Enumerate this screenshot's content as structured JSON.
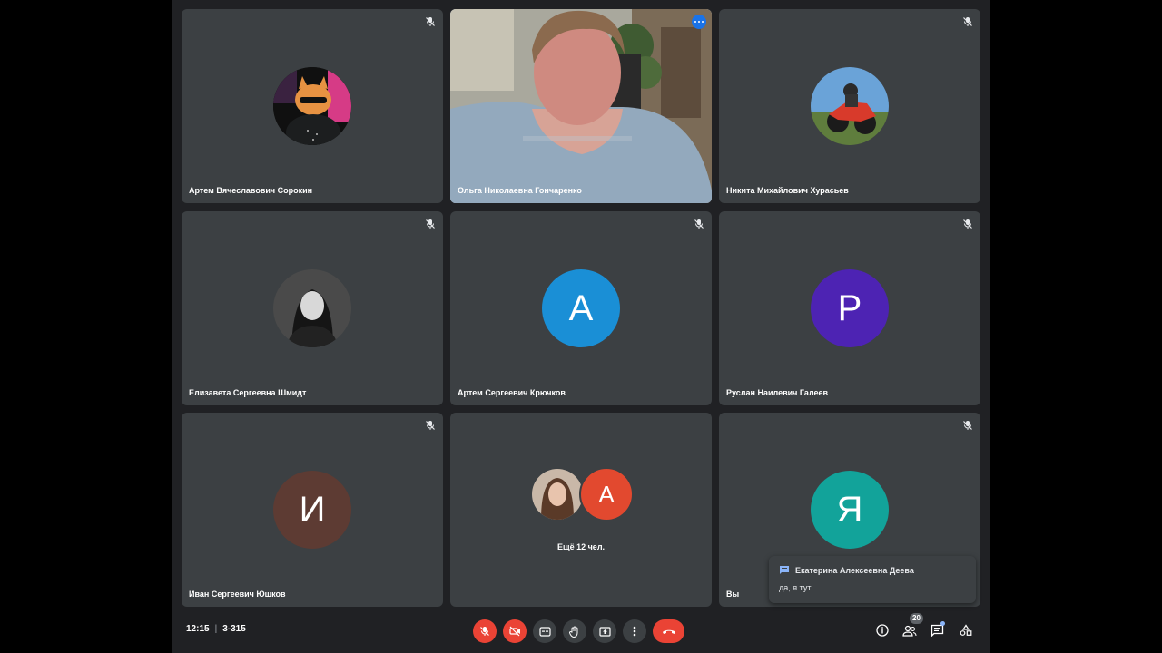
{
  "participants": [
    {
      "name": "Артем Вячеславович Сорокин",
      "avatar": "photo-cat"
    },
    {
      "name": "Ольга Николаевна Гончаренко",
      "avatar": "video"
    },
    {
      "name": "Никита Михайлович Хурасьев",
      "avatar": "photo-moto"
    },
    {
      "name": "Елизавета Сергеевна Шмидт",
      "avatar": "photo-girl"
    },
    {
      "name": "Артем Сергеевич Крючков",
      "initial": "А",
      "color": "#1a8fd6"
    },
    {
      "name": "Руслан Наилевич Галеев",
      "initial": "Р",
      "color": "#4d23b3"
    },
    {
      "name": "Иван Сергеевич Юшков",
      "initial": "И",
      "color": "#5d3b33"
    },
    {
      "group_initial": "А",
      "group_color": "#e2492f",
      "more_text": "Ещё 12 чел."
    },
    {
      "name": "Вы",
      "initial": "Я",
      "color": "#12a39a"
    }
  ],
  "toast": {
    "sender": "Екатерина Алексеевна Деева",
    "message": "да, я тут"
  },
  "bottom_bar": {
    "time": "12:15",
    "separator": "|",
    "meeting_code": "3-315",
    "people_count": "20"
  },
  "colors": {
    "background": "#202124",
    "tile": "#3c4043",
    "danger": "#ea4335",
    "accent": "#8ab4f8"
  }
}
